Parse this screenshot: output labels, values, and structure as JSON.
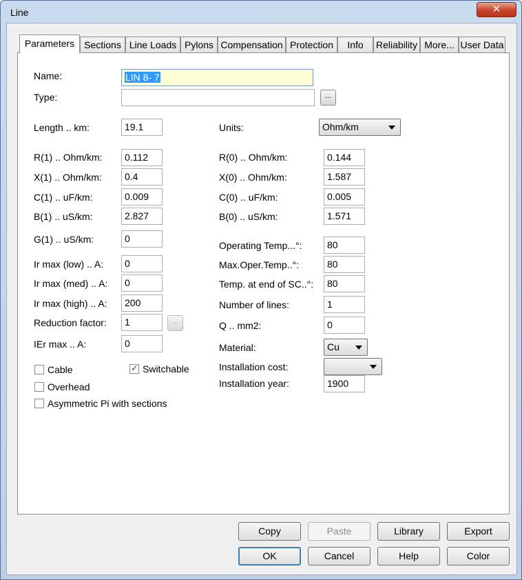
{
  "window": {
    "title": "Line",
    "close_glyph": "✕"
  },
  "tabs": [
    "Parameters",
    "Sections",
    "Line Loads",
    "Pylons",
    "Compensation",
    "Protection",
    "Info",
    "Reliability",
    "More...",
    "User Data"
  ],
  "active_tab": "Parameters",
  "header": {
    "name_label": "Name:",
    "name_value": "LIN 8- 7",
    "type_label": "Type:",
    "type_value": "",
    "browse_label": "..."
  },
  "left": {
    "length_label": "Length .. km:",
    "length_value": "19.1",
    "r1_label": "R(1) .. Ohm/km:",
    "r1_value": "0.112",
    "x1_label": "X(1) .. Ohm/km:",
    "x1_value": "0.4",
    "c1_label": "C(1) .. uF/km:",
    "c1_value": "0.009",
    "b1_label": "B(1) .. uS/km:",
    "b1_value": "2.827",
    "g1_label": "G(1) .. uS/km:",
    "g1_value": "0",
    "irlow_label": "Ir max (low) .. A:",
    "irlow_value": "0",
    "irmed_label": "Ir max (med) .. A:",
    "irmed_value": "0",
    "irhigh_label": "Ir max (high) .. A:",
    "irhigh_value": "200",
    "reduction_label": "Reduction factor:",
    "reduction_value": "1",
    "reduction_btn": "...",
    "ier_label": "IEr max .. A:",
    "ier_value": "0"
  },
  "right": {
    "units_label": "Units:",
    "units_value": "Ohm/km",
    "r0_label": "R(0) .. Ohm/km:",
    "r0_value": "0.144",
    "x0_label": "X(0) .. Ohm/km:",
    "x0_value": "1.587",
    "c0_label": "C(0) .. uF/km:",
    "c0_value": "0.005",
    "b0_label": "B(0) .. uS/km:",
    "b0_value": "1.571",
    "optemp_label": "Operating Temp...°:",
    "optemp_value": "80",
    "maxop_label": "Max.Oper.Temp..°:",
    "maxop_value": "80",
    "tempsc_label": "Temp. at end of SC..°:",
    "tempsc_value": "80",
    "nlines_label": "Number of lines:",
    "nlines_value": "1",
    "q_label": "Q .. mm2:",
    "q_value": "0",
    "material_label": "Material:",
    "material_value": "Cu",
    "instcost_label": "Installation cost:",
    "instcost_value": "",
    "instyear_label": "Installation year:",
    "instyear_value": "1900"
  },
  "checkboxes": {
    "cable": {
      "label": "Cable",
      "checked": false
    },
    "switchable": {
      "label": "Switchable",
      "checked": true
    },
    "overhead": {
      "label": "Overhead",
      "checked": false
    },
    "asym": {
      "label": "Asymmetric Pi with sections",
      "checked": false
    }
  },
  "buttons": {
    "copy": "Copy",
    "paste": "Paste",
    "library": "Library",
    "export": "Export",
    "ok": "OK",
    "cancel": "Cancel",
    "help": "Help",
    "color": "Color",
    "check_glyph": "✓"
  }
}
